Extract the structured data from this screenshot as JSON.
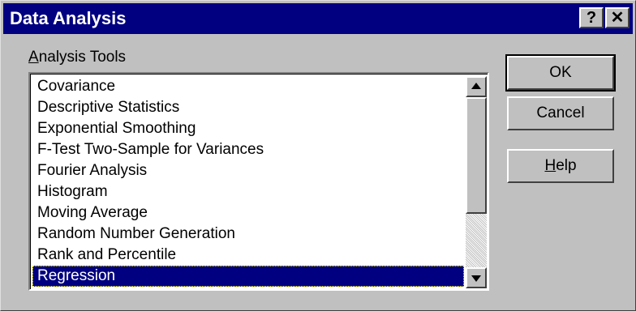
{
  "window": {
    "title": "Data Analysis",
    "help_glyph": "?",
    "close_glyph": "✕"
  },
  "section_label": {
    "accel": "A",
    "rest": "nalysis Tools"
  },
  "list": {
    "items": [
      "Covariance",
      "Descriptive Statistics",
      "Exponential Smoothing",
      "F-Test Two-Sample for Variances",
      "Fourier Analysis",
      "Histogram",
      "Moving Average",
      "Random Number Generation",
      "Rank and Percentile",
      "Regression"
    ],
    "selected_index": 9
  },
  "buttons": {
    "ok": "OK",
    "cancel": "Cancel",
    "help_accel": "H",
    "help_rest": "elp"
  },
  "icons": {
    "scroll_up": "triangle-up",
    "scroll_down": "triangle-down"
  }
}
